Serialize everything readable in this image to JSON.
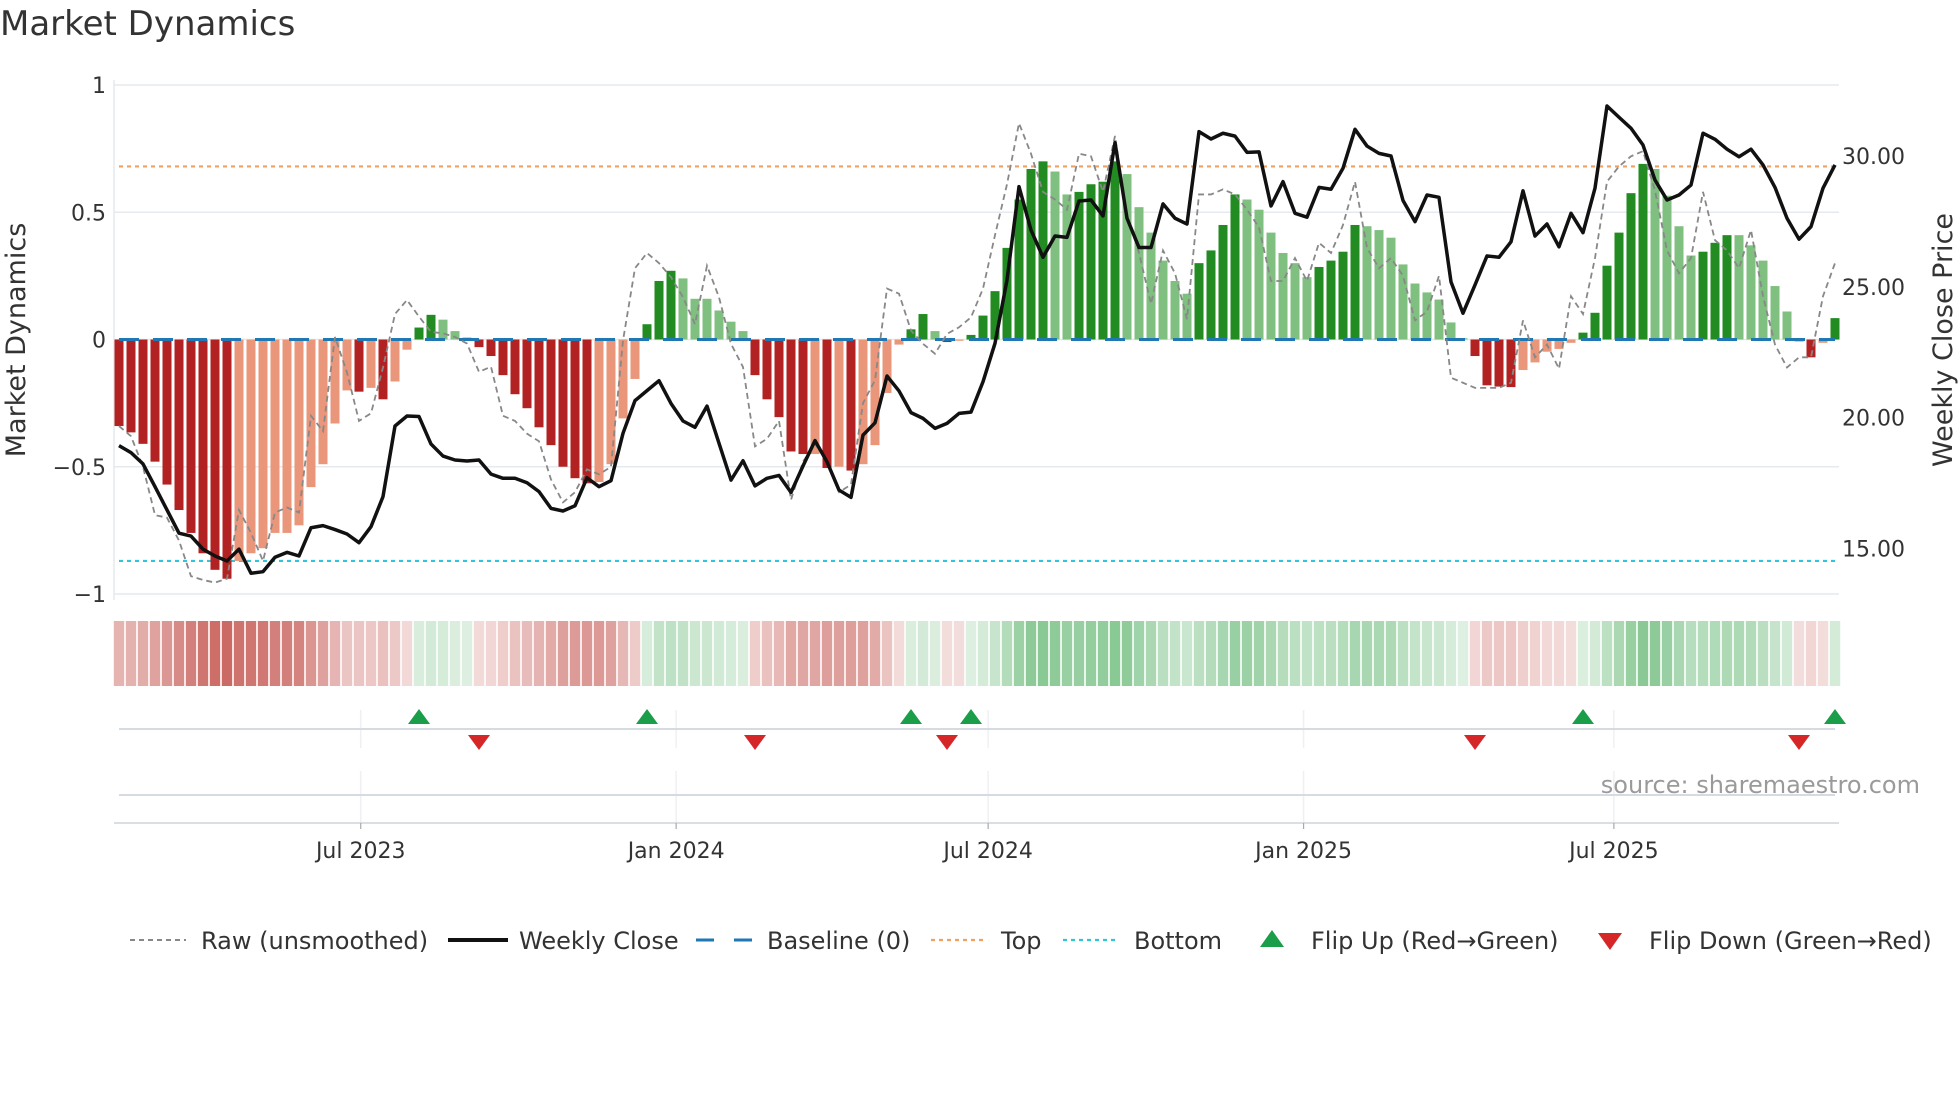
{
  "chart_data": {
    "type": "bar",
    "title": "Market Dynamics",
    "ylabel": "Market Dynamics",
    "y2label": "Weekly Close Price",
    "ylim": [
      -1,
      1
    ],
    "y2lim": [
      13.26,
      32.71
    ],
    "x_start": "2023-02-10",
    "x_step_days": 7,
    "grid": true,
    "legend_placement": "bottom",
    "source": "source: sharemaestro.com",
    "yticks": [
      {
        "value": 1,
        "label": "1"
      },
      {
        "value": 0.5,
        "label": "0.5"
      },
      {
        "value": 0,
        "label": "0"
      },
      {
        "value": -0.5,
        "label": "−0.5"
      },
      {
        "value": -1,
        "label": "−1"
      }
    ],
    "y2ticks": [
      {
        "value": 30,
        "label": "30.00"
      },
      {
        "value": 25,
        "label": "25.00"
      },
      {
        "value": 20,
        "label": "20.00"
      },
      {
        "value": 15,
        "label": "15.00"
      }
    ],
    "xticks": [
      {
        "date": "2023-07-01",
        "label": "Jul 2023"
      },
      {
        "date": "2024-01-01",
        "label": "Jan 2024"
      },
      {
        "date": "2024-07-01",
        "label": "Jul 2024"
      },
      {
        "date": "2025-01-01",
        "label": "Jan 2025"
      },
      {
        "date": "2025-07-01",
        "label": "Jul 2025"
      }
    ],
    "top_level": 0.68,
    "bottom_level": -0.87,
    "baseline": 0,
    "colors": {
      "neg_strong": "#b22222",
      "neg_weak": "#e9967a",
      "pos_strong": "#228b22",
      "pos_weak": "#7fbf7f",
      "strip_neg": "#c65a54",
      "strip_pos": "#5cb46c",
      "close": "#111111",
      "raw": "#888888",
      "baseline": "#1f77b4",
      "top": "#f0a060",
      "bottom": "#2ec7d8",
      "flip_up": "#1a9e4a",
      "flip_down": "#d62728"
    },
    "momentum": [
      -0.34,
      -0.365,
      -0.41,
      -0.48,
      -0.57,
      -0.67,
      -0.76,
      -0.84,
      -0.905,
      -0.94,
      -0.87,
      -0.84,
      -0.82,
      -0.76,
      -0.76,
      -0.73,
      -0.58,
      -0.49,
      -0.33,
      -0.2,
      -0.205,
      -0.19,
      -0.235,
      -0.165,
      -0.04,
      0.047,
      0.097,
      0.078,
      0.033,
      0.008,
      -0.03,
      -0.065,
      -0.14,
      -0.215,
      -0.27,
      -0.345,
      -0.415,
      -0.5,
      -0.545,
      -0.565,
      -0.56,
      -0.49,
      -0.31,
      -0.155,
      0.06,
      0.23,
      0.27,
      0.24,
      0.16,
      0.16,
      0.114,
      0.07,
      0.033,
      -0.14,
      -0.235,
      -0.305,
      -0.44,
      -0.45,
      -0.45,
      -0.505,
      -0.5,
      -0.515,
      -0.49,
      -0.415,
      -0.21,
      -0.02,
      0.04,
      0.1,
      0.033,
      -0.01,
      -0.005,
      0.018,
      0.094,
      0.19,
      0.36,
      0.55,
      0.67,
      0.7,
      0.66,
      0.57,
      0.58,
      0.61,
      0.62,
      0.7,
      0.65,
      0.52,
      0.42,
      0.31,
      0.23,
      0.18,
      0.3,
      0.35,
      0.45,
      0.57,
      0.55,
      0.51,
      0.42,
      0.34,
      0.3,
      0.245,
      0.285,
      0.31,
      0.345,
      0.45,
      0.445,
      0.43,
      0.4,
      0.295,
      0.22,
      0.185,
      0.157,
      0.067,
      0.005,
      -0.065,
      -0.18,
      -0.185,
      -0.187,
      -0.12,
      -0.09,
      -0.048,
      -0.037,
      -0.013,
      0.027,
      0.105,
      0.29,
      0.42,
      0.575,
      0.69,
      0.67,
      0.565,
      0.445,
      0.33,
      0.345,
      0.38,
      0.41,
      0.41,
      0.37,
      0.31,
      0.21,
      0.11,
      -0.007,
      -0.07,
      -0.013,
      0.084
    ],
    "strong": [
      1,
      1,
      1,
      1,
      1,
      1,
      1,
      1,
      1,
      1,
      0,
      0,
      0,
      0,
      0,
      0,
      0,
      0,
      0,
      0,
      1,
      0,
      1,
      0,
      0,
      1,
      1,
      0,
      0,
      0,
      1,
      1,
      1,
      1,
      1,
      1,
      1,
      1,
      1,
      1,
      0,
      0,
      0,
      0,
      1,
      1,
      1,
      0,
      0,
      0,
      0,
      0,
      0,
      1,
      1,
      1,
      1,
      1,
      0,
      1,
      0,
      1,
      0,
      0,
      0,
      0,
      1,
      1,
      0,
      1,
      0,
      1,
      1,
      1,
      1,
      1,
      1,
      1,
      0,
      0,
      1,
      1,
      1,
      1,
      0,
      0,
      0,
      0,
      0,
      0,
      1,
      1,
      1,
      1,
      0,
      0,
      0,
      0,
      0,
      0,
      1,
      1,
      1,
      1,
      0,
      0,
      0,
      0,
      0,
      0,
      0,
      0,
      0,
      1,
      1,
      1,
      1,
      0,
      0,
      0,
      0,
      0,
      1,
      1,
      1,
      1,
      1,
      1,
      0,
      0,
      0,
      0,
      1,
      1,
      1,
      0,
      0,
      0,
      0,
      0,
      1,
      1,
      0,
      1
    ],
    "raw": [
      -0.34,
      -0.38,
      -0.5,
      -0.69,
      -0.7,
      -0.79,
      -0.93,
      -0.945,
      -0.955,
      -0.94,
      -0.67,
      -0.76,
      -0.87,
      -0.68,
      -0.66,
      -0.68,
      -0.3,
      -0.36,
      0.01,
      -0.13,
      -0.32,
      -0.29,
      -0.11,
      0.1,
      0.155,
      0.09,
      0.03,
      0.024,
      0.01,
      -0.016,
      -0.127,
      -0.107,
      -0.3,
      -0.32,
      -0.37,
      -0.4,
      -0.55,
      -0.64,
      -0.6,
      -0.51,
      -0.53,
      -0.5,
      -0.004,
      0.28,
      0.34,
      0.3,
      0.245,
      0.166,
      0.06,
      0.29,
      0.166,
      -0.017,
      -0.108,
      -0.42,
      -0.39,
      -0.32,
      -0.63,
      -0.48,
      -0.41,
      -0.48,
      -0.6,
      -0.57,
      -0.25,
      -0.16,
      0.2,
      0.18,
      0.035,
      -0.017,
      -0.056,
      0.022,
      0.048,
      0.087,
      0.2,
      0.41,
      0.61,
      0.85,
      0.73,
      0.58,
      0.55,
      0.51,
      0.73,
      0.72,
      0.58,
      0.8,
      0.49,
      0.34,
      0.14,
      0.35,
      0.26,
      0.08,
      0.57,
      0.57,
      0.59,
      0.57,
      0.51,
      0.44,
      0.23,
      0.23,
      0.32,
      0.23,
      0.38,
      0.34,
      0.45,
      0.62,
      0.36,
      0.28,
      0.32,
      0.25,
      0.075,
      0.11,
      0.25,
      -0.15,
      -0.17,
      -0.19,
      -0.19,
      -0.19,
      -0.17,
      0.075,
      -0.07,
      -0.02,
      -0.115,
      0.17,
      0.1,
      0.32,
      0.62,
      0.68,
      0.72,
      0.74,
      0.585,
      0.35,
      0.26,
      0.32,
      0.58,
      0.39,
      0.35,
      0.28,
      0.43,
      0.17,
      -0.02,
      -0.11,
      -0.07,
      -0.07,
      0.17,
      0.3
    ],
    "close": [
      18.93,
      18.66,
      18.23,
      17.36,
      16.47,
      15.58,
      15.47,
      14.97,
      14.71,
      14.52,
      14.97,
      14.05,
      14.11,
      14.66,
      14.85,
      14.71,
      15.79,
      15.87,
      15.72,
      15.55,
      15.22,
      15.83,
      16.98,
      19.68,
      20.06,
      20.04,
      18.99,
      18.53,
      18.38,
      18.34,
      18.38,
      17.84,
      17.68,
      17.68,
      17.51,
      17.17,
      16.53,
      16.43,
      16.63,
      17.7,
      17.36,
      17.59,
      19.4,
      20.65,
      21.03,
      21.41,
      20.54,
      19.87,
      19.63,
      20.44,
      19.02,
      17.61,
      18.35,
      17.39,
      17.68,
      17.79,
      17.14,
      18.15,
      19.12,
      18.31,
      17.23,
      16.95,
      19.33,
      19.8,
      21.59,
      21.02,
      20.19,
      19.97,
      19.59,
      19.78,
      20.16,
      20.21,
      21.37,
      22.84,
      25.26,
      28.83,
      27.17,
      26.13,
      26.94,
      26.89,
      28.28,
      28.32,
      27.71,
      30.51,
      27.62,
      26.5,
      26.5,
      28.17,
      27.62,
      27.4,
      30.93,
      30.65,
      30.87,
      30.76,
      30.14,
      30.16,
      28.09,
      29.02,
      27.81,
      27.66,
      28.8,
      28.73,
      29.53,
      31.02,
      30.38,
      30.1,
      30.0,
      28.3,
      27.49,
      28.51,
      28.42,
      25.19,
      23.99,
      25.07,
      26.18,
      26.13,
      26.72,
      28.67,
      26.94,
      27.4,
      26.53,
      27.81,
      27.07,
      28.77,
      31.91,
      31.48,
      31.06,
      30.42,
      29.08,
      28.32,
      28.51,
      28.89,
      30.87,
      30.64,
      30.26,
      29.97,
      30.26,
      29.66,
      28.8,
      27.62,
      26.82,
      27.3,
      28.77,
      29.66
    ],
    "flip_up_weeks": [
      25,
      44,
      66,
      71,
      122,
      143
    ],
    "flip_down_weeks": [
      30,
      53,
      69,
      113,
      140
    ],
    "legend": [
      {
        "key": "raw",
        "label": "Raw (unsmoothed)"
      },
      {
        "key": "close",
        "label": "Weekly Close"
      },
      {
        "key": "baseline",
        "label": "Baseline (0)"
      },
      {
        "key": "top",
        "label": "Top"
      },
      {
        "key": "bottom",
        "label": "Bottom"
      },
      {
        "key": "flip_up",
        "label": "Flip Up (Red→Green)"
      },
      {
        "key": "flip_down",
        "label": "Flip Down (Green→Red)"
      }
    ]
  }
}
